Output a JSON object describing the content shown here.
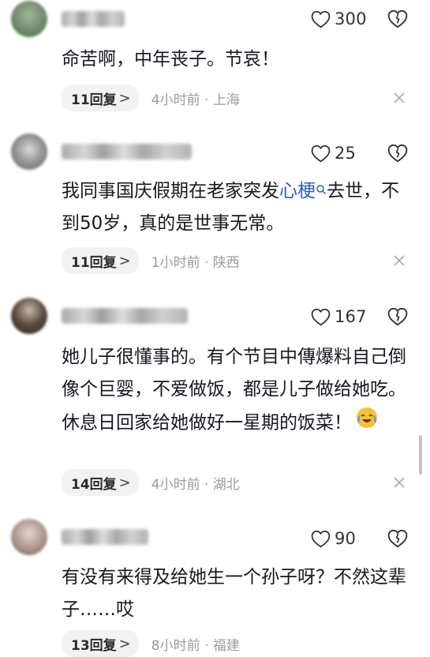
{
  "comments": [
    {
      "likes": "300",
      "text": "命苦啊，中年丧子。节哀！",
      "replies": "11回复",
      "meta": "4小时前 · 上海",
      "avatar_color": "#6f8a6a"
    },
    {
      "likes": "25",
      "text_before": "我同事国庆假期在老家突发",
      "text_link": "心梗",
      "text_after": "去世，不到50岁，真的是世事无常。",
      "replies": "11回复",
      "meta": "1小时前 · 陕西",
      "avatar_color": "#8e8e8e"
    },
    {
      "likes": "167",
      "text": "她儿子很懂事的。有个节目中傳爆料自己倒像个巨婴，不爱做饭，都是儿子做给她吃。休息日回家给她做好一星期的饭菜！",
      "emoji": "crying-laughing",
      "replies": "14回复",
      "meta": "4小时前 · 湖北",
      "avatar_color": "#5a4a3e"
    },
    {
      "likes": "90",
      "text": "有没有来得及给她生一个孙子呀？不然这辈子……哎",
      "replies": "13回复",
      "meta": "8小时前 · 福建",
      "avatar_color": "#b09a90"
    }
  ],
  "colors": {
    "link": "#2f5fb3",
    "meta": "#9b9b9b",
    "reply_bg": "#f2f2f3"
  }
}
